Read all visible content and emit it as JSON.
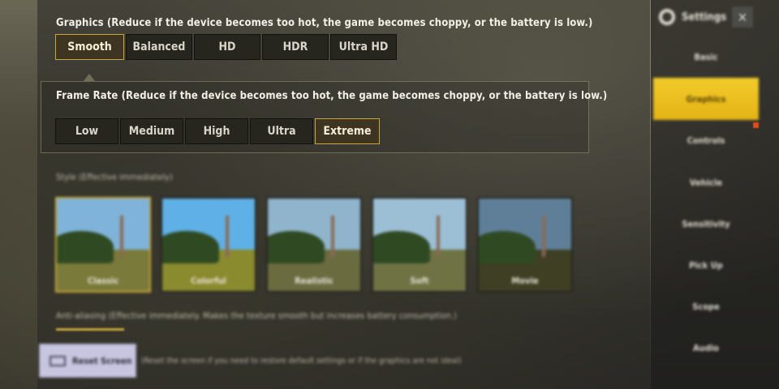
{
  "graphics": {
    "title": "Graphics (Reduce if the device becomes too hot, the game becomes choppy, or the battery is low.)",
    "options": [
      "Smooth",
      "Balanced",
      "HD",
      "HDR",
      "Ultra HD"
    ],
    "selected": "Smooth"
  },
  "frame_rate": {
    "title": "Frame Rate (Reduce if the device becomes too hot, the game becomes choppy, or the battery is low.)",
    "options": [
      "Low",
      "Medium",
      "High",
      "Ultra",
      "Extreme"
    ],
    "selected": "Extreme"
  },
  "style": {
    "label": "Style (Effective immediately)",
    "options": [
      {
        "label": "Classic",
        "sky": "#7fb3d9",
        "ground": "#7a7a3a"
      },
      {
        "label": "Colorful",
        "sky": "#5fb0e6",
        "ground": "#8a8a2e"
      },
      {
        "label": "Realistic",
        "sky": "#8fb4cc",
        "ground": "#6b6b40"
      },
      {
        "label": "Soft",
        "sky": "#9cbfd6",
        "ground": "#6f7344"
      },
      {
        "label": "Movie",
        "sky": "#5f7f99",
        "ground": "#3f3f24"
      }
    ],
    "selected": "Classic"
  },
  "anti_aliasing": {
    "label": "Anti-aliasing (Effective immediately. Makes the texture smooth but increases battery consumption.)"
  },
  "reset": {
    "label": "Reset Screen",
    "note": "(Reset the screen if you need to restore default settings or if the graphics are not ideal)"
  },
  "sidebar": {
    "title": "Settings",
    "close_glyph": "✕",
    "items": [
      "Basic",
      "Graphics",
      "Controls",
      "Vehicle",
      "Sensitivity",
      "Pick Up",
      "Scope",
      "Audio"
    ],
    "selected": "Graphics"
  },
  "colors": {
    "accent": "#c9a73c",
    "sidebar_active": "#f2cc2a",
    "badge": "#e04a1a"
  }
}
